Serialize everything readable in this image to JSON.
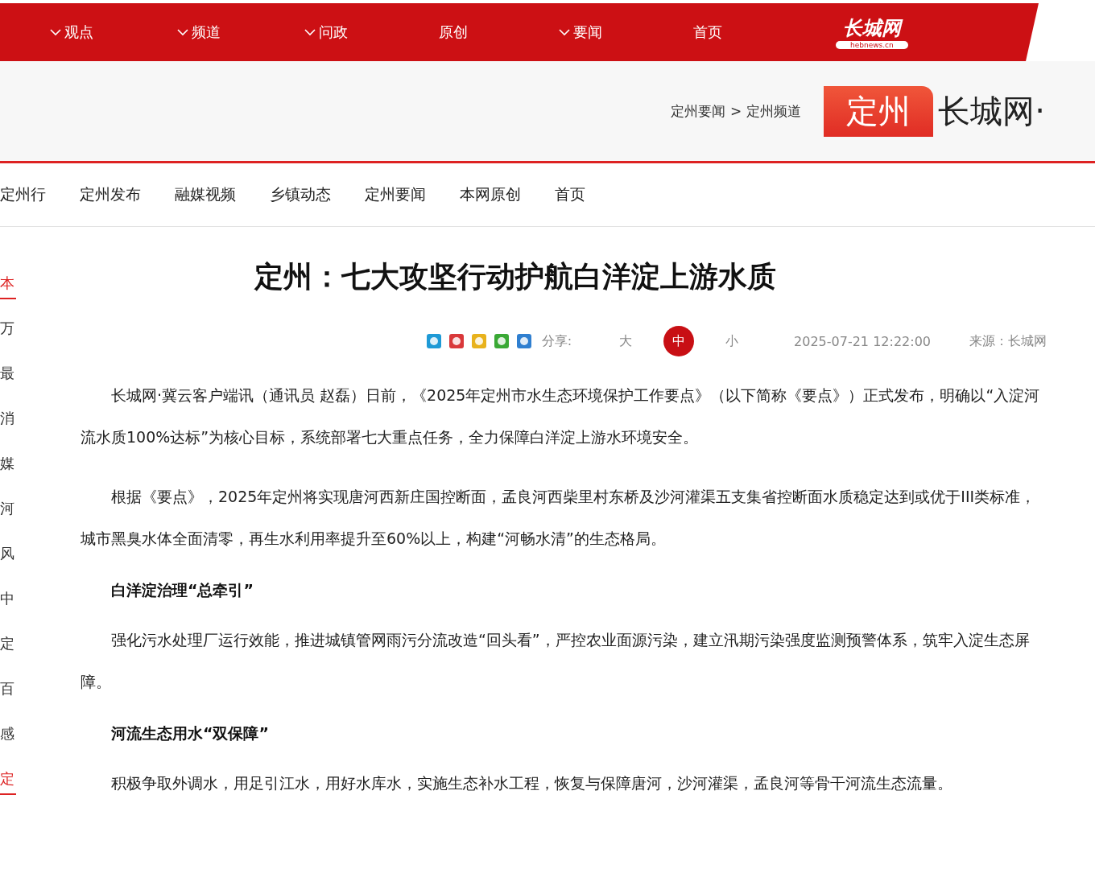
{
  "top_nav": {
    "logo": "长城网",
    "logo_sub": "hebnews.cn",
    "items": [
      {
        "label": "观点",
        "dropdown": true
      },
      {
        "label": "频道",
        "dropdown": true
      },
      {
        "label": "问政",
        "dropdown": true
      },
      {
        "label": "原创",
        "dropdown": false
      },
      {
        "label": "要闻",
        "dropdown": true
      },
      {
        "label": "首页",
        "dropdown": false
      }
    ]
  },
  "header": {
    "breadcrumb": [
      "定州要闻",
      "定州频道"
    ],
    "separator": ">",
    "channel": "定州",
    "site": "长城网·"
  },
  "channel_nav": [
    "定州行",
    "定州发布",
    "融媒视频",
    "乡镇动态",
    "定州要闻",
    "本网原创",
    "首页"
  ],
  "side_list": [
    {
      "text": "本",
      "kind": "heading"
    },
    {
      "text": "万",
      "kind": "item"
    },
    {
      "text": "最",
      "kind": "item"
    },
    {
      "text": "消",
      "kind": "item"
    },
    {
      "text": "媒",
      "kind": "item"
    },
    {
      "text": "河",
      "kind": "item"
    },
    {
      "text": "风",
      "kind": "item"
    },
    {
      "text": "中",
      "kind": "item"
    },
    {
      "text": "定",
      "kind": "item"
    },
    {
      "text": "百",
      "kind": "item"
    },
    {
      "text": "感",
      "kind": "item"
    },
    {
      "text": "定",
      "kind": "heading"
    }
  ],
  "article": {
    "title": "定州：七大攻坚行动护航白洋淀上游水质",
    "share_label": "分享:",
    "font_sizes": [
      {
        "label": "大",
        "selected": false
      },
      {
        "label": "中",
        "selected": true
      },
      {
        "label": "小",
        "selected": false
      }
    ],
    "time": "2025-07-21 12:22:00",
    "source": "来源：长城网",
    "blocks": [
      {
        "kind": "para",
        "text": "长城网·冀云客户端讯（通讯员 赵磊）日前，《2025年定州市水生态环境保护工作要点》（以下简称《要点》）正式发布，明确以“入淀河流水质100%达标”为核心目标，系统部署七大重点任务，全力保障白洋淀上游水环境安全。"
      },
      {
        "kind": "para",
        "text": "根据《要点》，2025年定州将实现唐河西新庄国控断面，孟良河西柴里村东桥及沙河灌渠五支集省控断面水质稳定达到或优于III类标准，城市黑臭水体全面清零，再生水利用率提升至60%以上，构建“河畅水清”的生态格局。"
      },
      {
        "kind": "heading",
        "text": "白洋淀治理“总牵引”"
      },
      {
        "kind": "para",
        "text": "强化污水处理厂运行效能，推进城镇管网雨污分流改造“回头看”，严控农业面源污染，建立汛期污染强度监测预警体系，筑牢入淀生态屏障。"
      },
      {
        "kind": "heading",
        "text": "河流生态用水“双保障”"
      },
      {
        "kind": "para",
        "text": "积极争取外调水，用足引江水，用好水库水，实施生态补水工程，恢复与保障唐河，沙河灌渠，孟良河等骨干河流生态流量。"
      }
    ]
  }
}
